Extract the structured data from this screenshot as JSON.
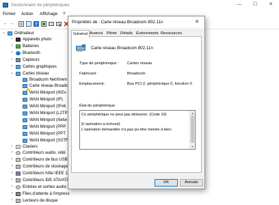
{
  "window": {
    "title": "Gestionnaire de périphériques",
    "minimize": "—",
    "maximize": "☐",
    "close": "✕"
  },
  "menu": [
    "Fichier",
    "Action",
    "Affichage",
    "?"
  ],
  "toolbar": {
    "back": "←",
    "forward": "→"
  },
  "tree": {
    "root": "Ordinateur",
    "items": [
      {
        "label": "Appareils photo"
      },
      {
        "label": "Batteries"
      },
      {
        "label": "Bluetooth"
      },
      {
        "label": "Capteurs"
      },
      {
        "label": "Cartes graphiques"
      },
      {
        "label": "Cartes réseau"
      },
      {
        "label": "Broadcom NetXtrem"
      },
      {
        "label": "Carte réseau Broadc"
      },
      {
        "label": "WAN Miniport (IKEv"
      },
      {
        "label": "WAN Miniport (IP)"
      },
      {
        "label": "WAN Miniport (IPv6"
      },
      {
        "label": "WAN Miniport (L2TP"
      },
      {
        "label": "WAN Miniport (Netw"
      },
      {
        "label": "WAN Miniport (PPP"
      },
      {
        "label": "WAN Miniport (PPT"
      },
      {
        "label": "WAN Miniport (SSTF"
      },
      {
        "label": "Claviers"
      },
      {
        "label": "Contrôleurs audio, vidé"
      },
      {
        "label": "Contrôleurs de bus USB"
      },
      {
        "label": "Contrôleurs de stockage"
      },
      {
        "label": "Contrôleurs hôte IEEE 13"
      },
      {
        "label": "Contrôleurs IDE ATA/ATA"
      },
      {
        "label": "Entrées et sorties audio"
      },
      {
        "label": "Files d'attente à l'impression"
      },
      {
        "label": "Lecteurs de disque"
      }
    ]
  },
  "dialog": {
    "title": "Propriétés de : Carte réseau Broadcom 802.11n",
    "close": "✕",
    "tabs": [
      "Général",
      "Avancé",
      "Pilote",
      "Détails",
      "Événements",
      "Ressources"
    ],
    "active_tab": "Général",
    "device_name": "Carte réseau Broadcom 802.11n",
    "properties": [
      {
        "label": "Type de périphérique :",
        "value": "Cartes réseau"
      },
      {
        "label": "Fabricant :",
        "value": "Broadcom"
      },
      {
        "label": "Emplacement :",
        "value": "Bus PCI 2, périphérique 0, fonction 0"
      }
    ],
    "status_label": "État du périphérique",
    "status_text": "Ce périphérique ne peut pas démarrer. (Code 10)\n\n{L'opération a échoué}\nL'opération demandée n'a pas pu être menée à bien.",
    "ok": "OK",
    "cancel": "Annuler"
  }
}
